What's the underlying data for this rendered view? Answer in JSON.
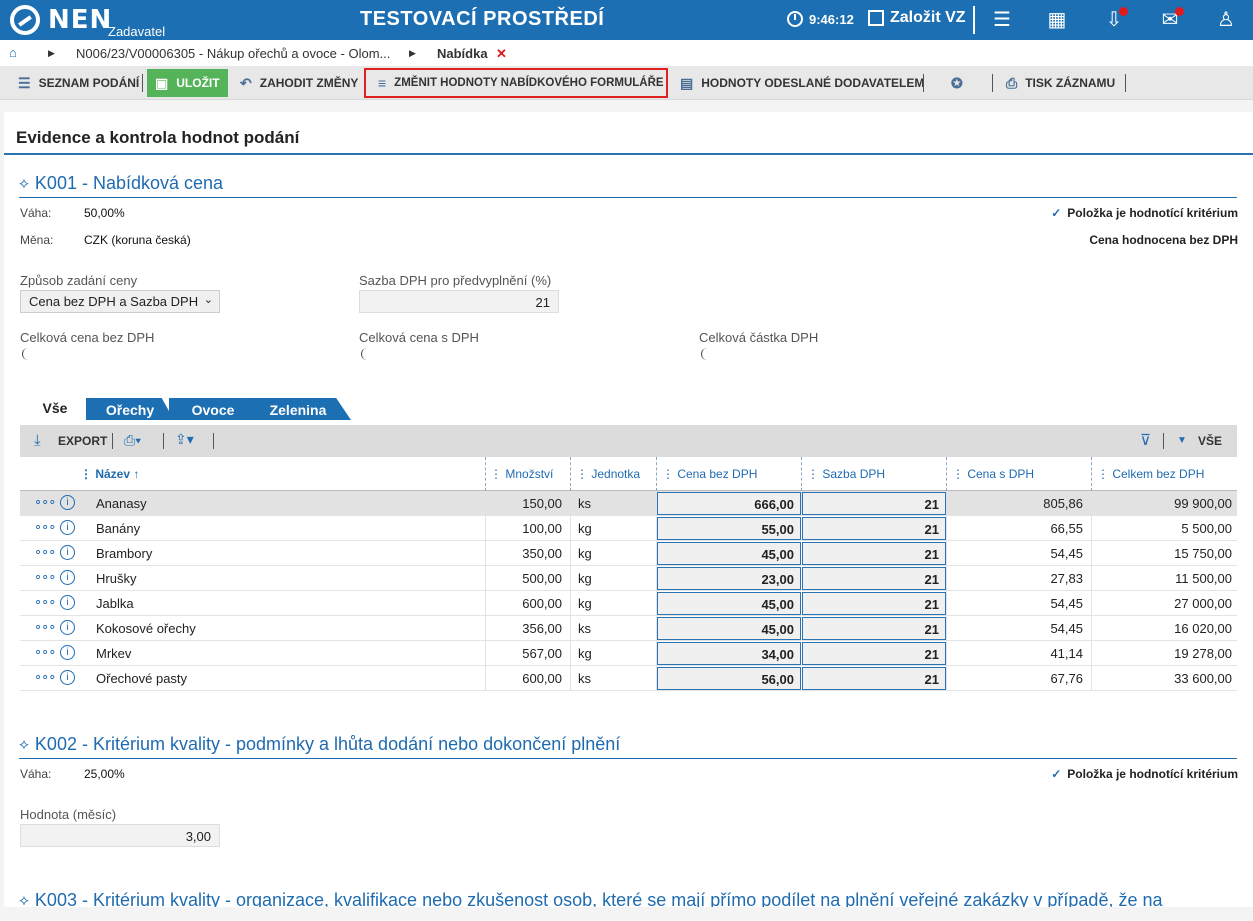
{
  "header": {
    "logo_text": "NEN",
    "logo_sub": "Zadavatel",
    "env_title": "TESTOVACÍ PROSTŘEDÍ",
    "clock": "9:46:12",
    "create_label": "Založit VZ"
  },
  "breadcrumb": {
    "path1": "N006/23/V00006305 - Nákup ořechů a ovoce - Olom...",
    "current": "Nabídka",
    "close": "✕"
  },
  "toolbar": {
    "list": "SEZNAM PODÁNÍ",
    "save": "ULOŽIT",
    "discard": "ZAHODIT ZMĚNY",
    "change": "ZMĚNIT HODNOTY NABÍDKOVÉHO FORMULÁŘE",
    "sent": "HODNOTY ODESLANÉ DODAVATELEM",
    "print": "TISK ZÁZNAMU"
  },
  "page_title": "Evidence a kontrola hodnot podání",
  "k001": {
    "title": "K001 - Nabídková cena",
    "vaha_label": "Váha:",
    "vaha": "50,00%",
    "mena_label": "Měna:",
    "mena": "CZK (koruna česká)",
    "criterion_note": "Položka je hodnotící kritérium",
    "evaluated_note": "Cena hodnocena bez DPH",
    "zpusob_label": "Způsob zadání ceny",
    "zpusob_value": "Cena bez DPH a Sazba DPH",
    "sazba_label": "Sazba DPH pro předvyplnění (%)",
    "sazba_value": "21",
    "total_no_vat_label": "Celková cena bez DPH",
    "total_vat_label": "Celková cena s DPH",
    "total_amount_label": "Celková částka DPH"
  },
  "tabs": [
    "Vše",
    "Ořechy",
    "Ovoce",
    "Zelenina"
  ],
  "grid_toolbar": {
    "export": "EXPORT",
    "all": "VŠE"
  },
  "columns": [
    "Název",
    "Množství",
    "Jednotka",
    "Cena bez DPH",
    "Sazba DPH",
    "Cena s DPH",
    "Celkem bez DPH"
  ],
  "rows": [
    {
      "name": "Ananasy",
      "qty": "150,00",
      "unit": "ks",
      "price": "666,00",
      "vat": "21",
      "price_vat": "805,86",
      "total": "99 900,00"
    },
    {
      "name": "Banány",
      "qty": "100,00",
      "unit": "kg",
      "price": "55,00",
      "vat": "21",
      "price_vat": "66,55",
      "total": "5 500,00"
    },
    {
      "name": "Brambory",
      "qty": "350,00",
      "unit": "kg",
      "price": "45,00",
      "vat": "21",
      "price_vat": "54,45",
      "total": "15 750,00"
    },
    {
      "name": "Hrušky",
      "qty": "500,00",
      "unit": "kg",
      "price": "23,00",
      "vat": "21",
      "price_vat": "27,83",
      "total": "11 500,00"
    },
    {
      "name": "Jablka",
      "qty": "600,00",
      "unit": "kg",
      "price": "45,00",
      "vat": "21",
      "price_vat": "54,45",
      "total": "27 000,00"
    },
    {
      "name": "Kokosové ořechy",
      "qty": "356,00",
      "unit": "ks",
      "price": "45,00",
      "vat": "21",
      "price_vat": "54,45",
      "total": "16 020,00"
    },
    {
      "name": "Mrkev",
      "qty": "567,00",
      "unit": "kg",
      "price": "34,00",
      "vat": "21",
      "price_vat": "41,14",
      "total": "19 278,00"
    },
    {
      "name": "Ořechové pasty",
      "qty": "600,00",
      "unit": "ks",
      "price": "56,00",
      "vat": "21",
      "price_vat": "67,76",
      "total": "33 600,00"
    }
  ],
  "k002": {
    "title": "K002 - Kritérium kvality - podmínky a lhůta dodání nebo dokončení plnění",
    "vaha_label": "Váha:",
    "vaha": "25,00%",
    "criterion_note": "Položka je hodnotící kritérium",
    "value_label": "Hodnota (měsíc)",
    "value": "3,00"
  },
  "k003": {
    "title": "K003 - Kritérium kvality - organizace, kvalifikace nebo zkušenost osob, které se mají přímo podílet na plnění veřejné zakázky v případě, že na"
  }
}
